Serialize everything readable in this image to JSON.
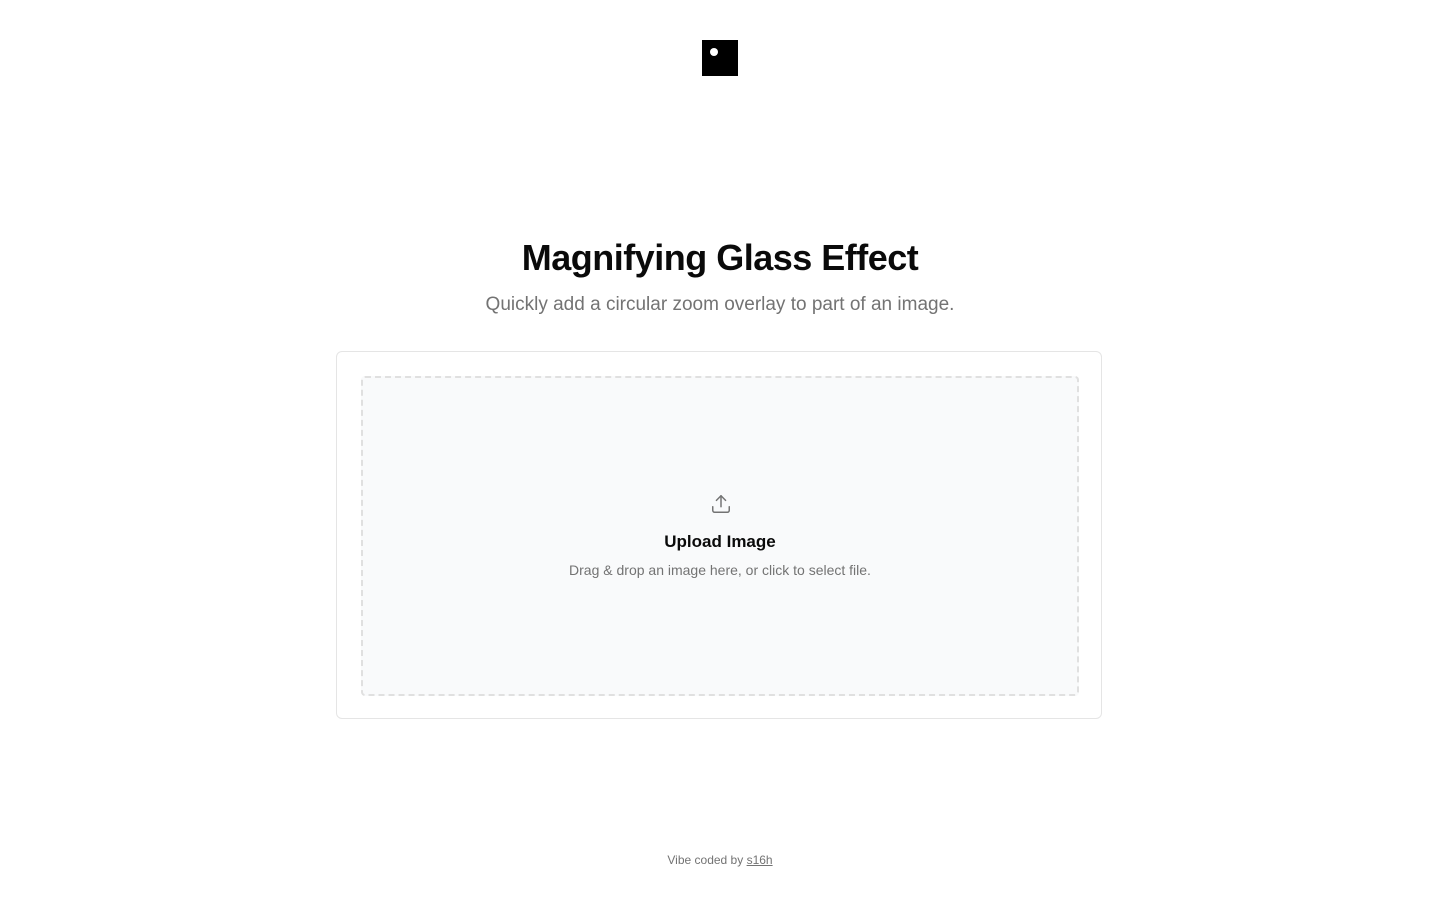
{
  "header": {
    "logo_icon": "square-logo-icon"
  },
  "hero": {
    "title": "Magnifying Glass Effect",
    "subtitle": "Quickly add a circular zoom overlay to part of an image."
  },
  "upload": {
    "icon": "upload-icon",
    "title": "Upload Image",
    "hint": "Drag & drop an image here, or click to select file."
  },
  "footer": {
    "prefix": "Vibe coded by",
    "author_link": "s16h"
  },
  "colors": {
    "text_primary": "#0a0a0a",
    "text_muted": "#737373",
    "border": "#e5e5e5",
    "dropzone_bg": "#f9fafb",
    "logo": "#000000"
  }
}
